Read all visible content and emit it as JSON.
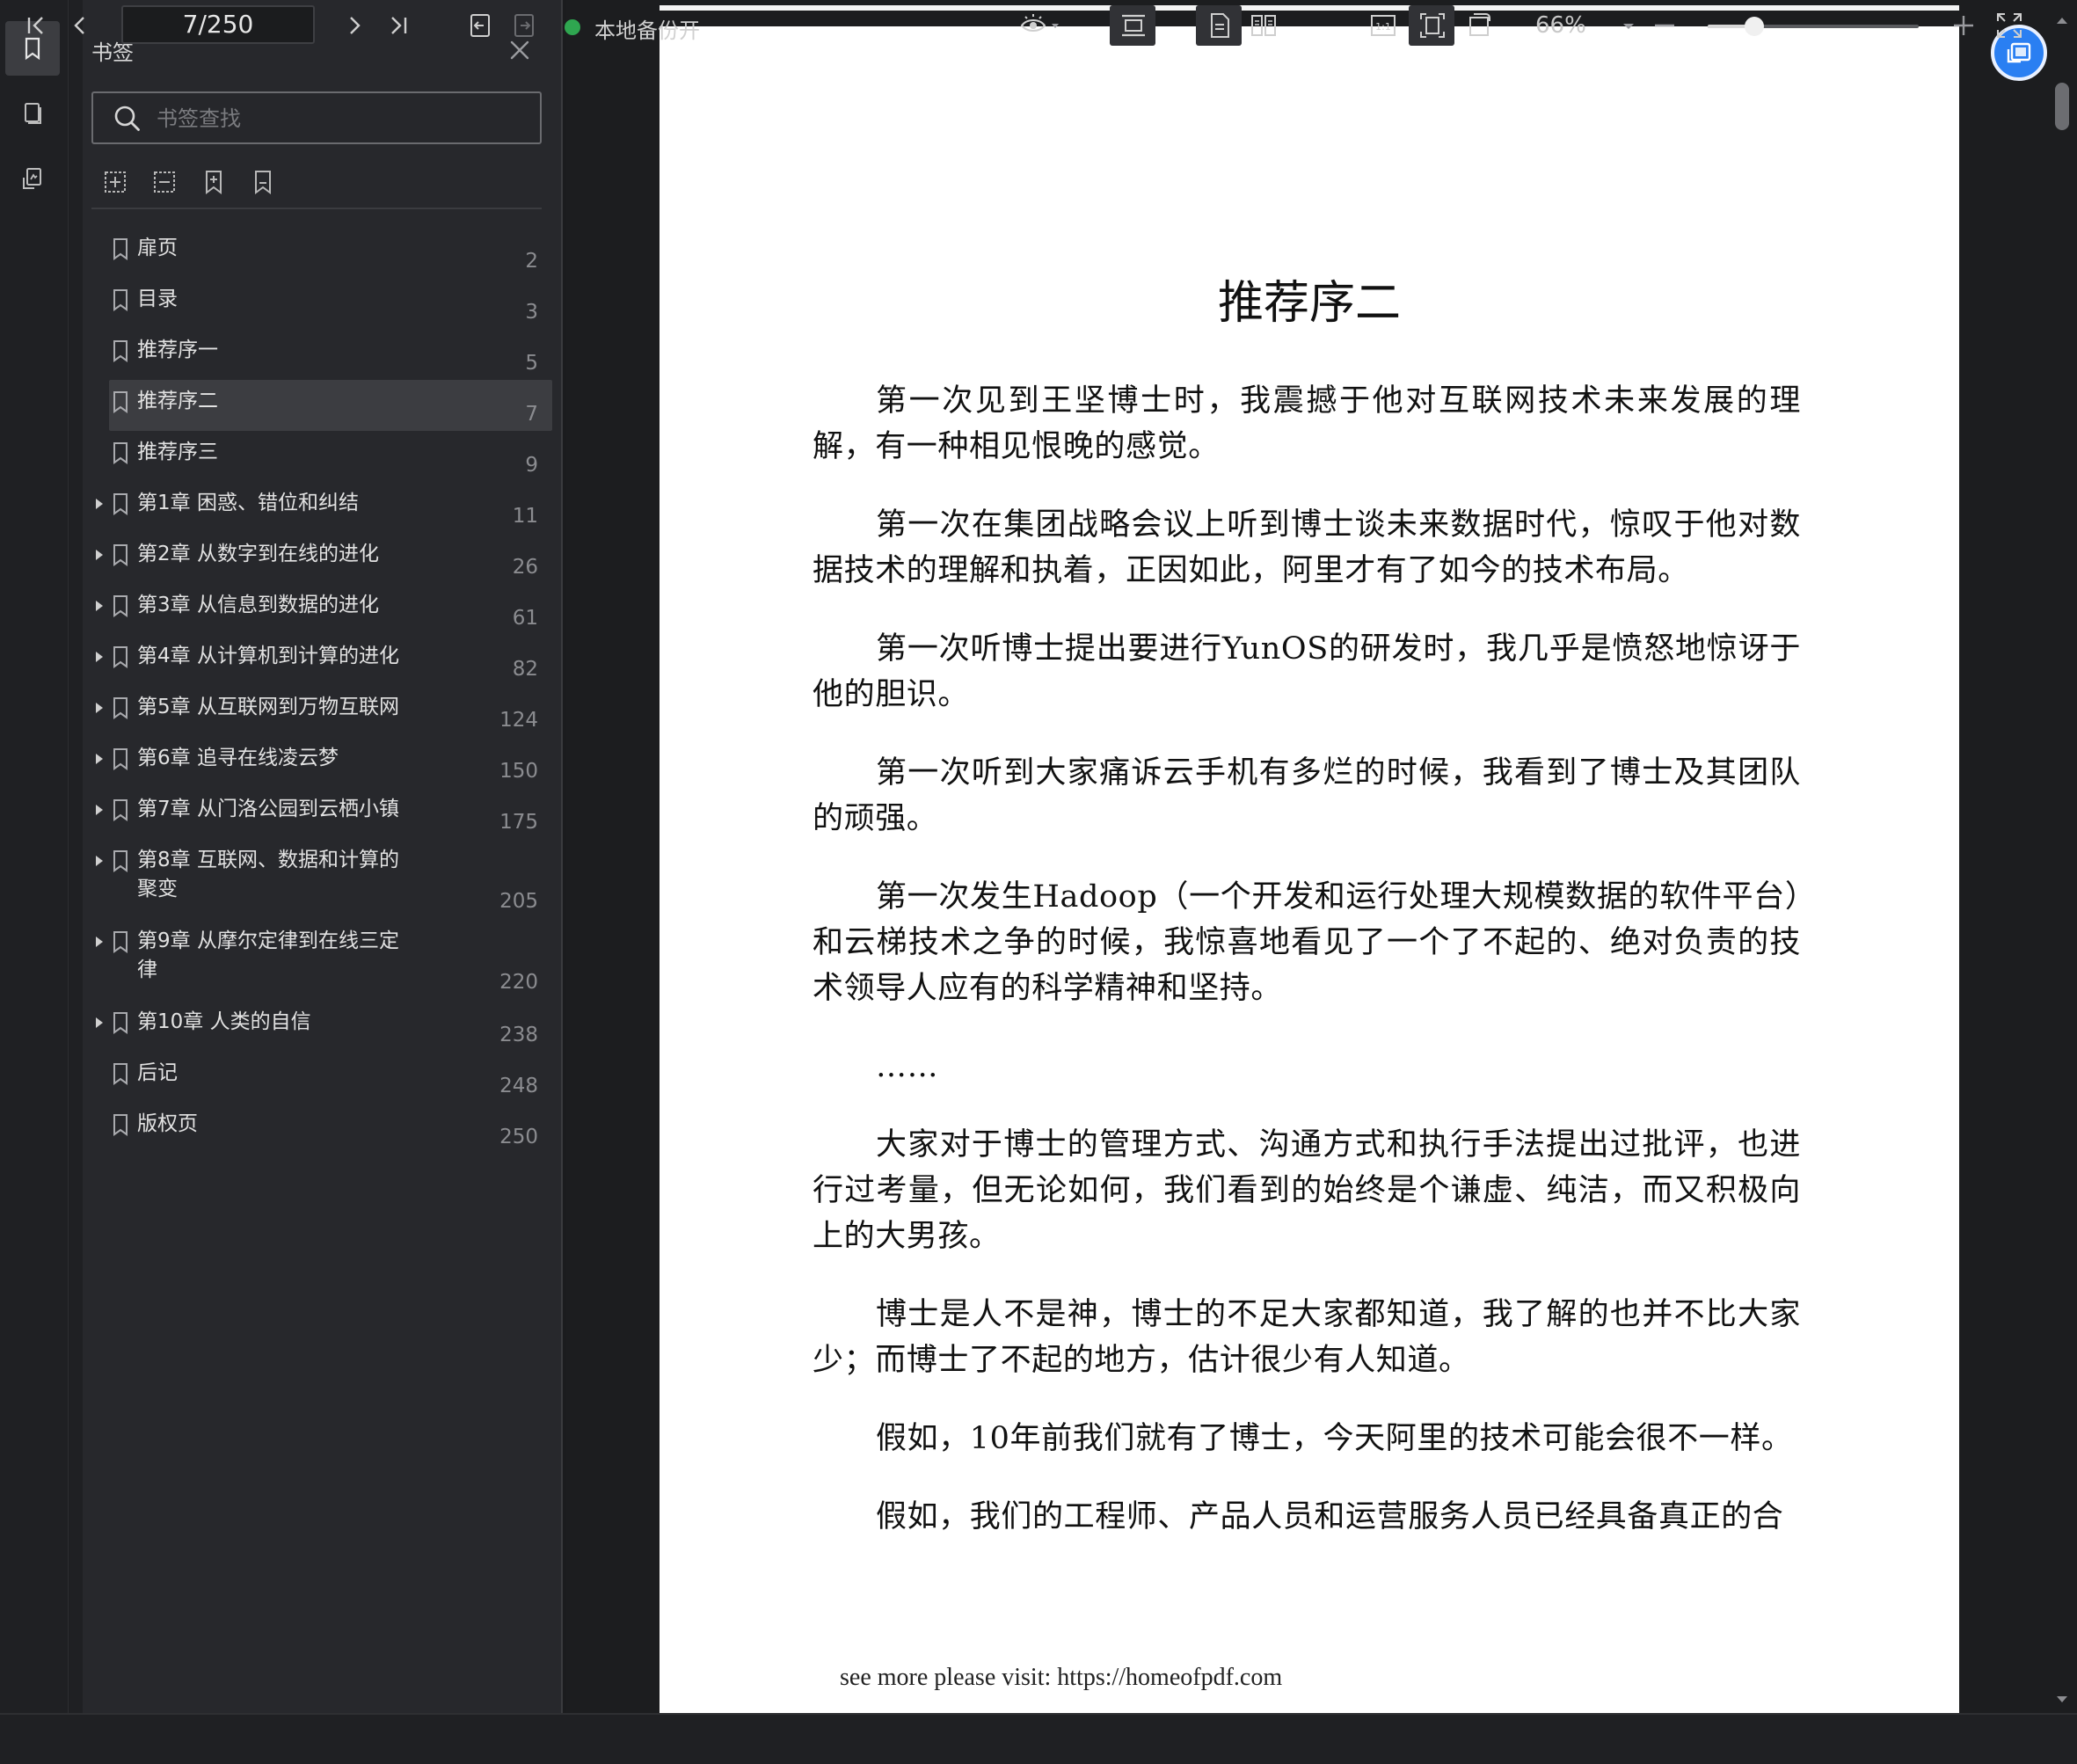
{
  "sidebar": {
    "title": "书签",
    "search_placeholder": "书签查找",
    "items": [
      {
        "label": "扉页",
        "page": "2",
        "expandable": false,
        "selected": false
      },
      {
        "label": "目录",
        "page": "3",
        "expandable": false,
        "selected": false
      },
      {
        "label": "推荐序一",
        "page": "5",
        "expandable": false,
        "selected": false
      },
      {
        "label": "推荐序二",
        "page": "7",
        "expandable": false,
        "selected": true
      },
      {
        "label": "推荐序三",
        "page": "9",
        "expandable": false,
        "selected": false
      },
      {
        "label": "第1章 困惑、错位和纠结",
        "page": "11",
        "expandable": true,
        "selected": false
      },
      {
        "label": "第2章 从数字到在线的进化",
        "page": "26",
        "expandable": true,
        "selected": false
      },
      {
        "label": "第3章 从信息到数据的进化",
        "page": "61",
        "expandable": true,
        "selected": false
      },
      {
        "label": "第4章 从计算机到计算的进化",
        "page": "82",
        "expandable": true,
        "selected": false
      },
      {
        "label": "第5章 从互联网到万物互联网",
        "page": "124",
        "expandable": true,
        "selected": false
      },
      {
        "label": "第6章 追寻在线凌云梦",
        "page": "150",
        "expandable": true,
        "selected": false
      },
      {
        "label": "第7章 从门洛公园到云栖小镇",
        "page": "175",
        "expandable": true,
        "selected": false
      },
      {
        "label": "第8章 互联网、数据和计算的聚变",
        "page": "205",
        "expandable": true,
        "selected": false
      },
      {
        "label": "第9章 从摩尔定律到在线三定律",
        "page": "220",
        "expandable": true,
        "selected": false
      },
      {
        "label": "第10章 人类的自信",
        "page": "238",
        "expandable": true,
        "selected": false
      },
      {
        "label": "后记",
        "page": "248",
        "expandable": false,
        "selected": false
      },
      {
        "label": "版权页",
        "page": "250",
        "expandable": false,
        "selected": false
      }
    ]
  },
  "document": {
    "title": "推荐序二",
    "paragraphs": [
      "第一次见到王坚博士时，我震撼于他对互联网技术未来发展的理解，有一种相见恨晚的感觉。",
      "第一次在集团战略会议上听到博士谈未来数据时代，惊叹于他对数据技术的理解和执着，正因如此，阿里才有了如今的技术布局。",
      "第一次听博士提出要进行YunOS的研发时，我几乎是愤怒地惊讶于他的胆识。",
      "第一次听到大家痛诉云手机有多烂的时候，我看到了博士及其团队的顽强。",
      "第一次发生Hadoop（一个开发和运行处理大规模数据的软件平台）和云梯技术之争的时候，我惊喜地看见了一个了不起的、绝对负责的技术领导人应有的科学精神和坚持。",
      "……",
      "大家对于博士的管理方式、沟通方式和执行手法提出过批评，也进行过考量，但无论如何，我们看到的始终是个谦虚、纯洁，而又积极向上的大男孩。",
      "博士是人不是神，博士的不足大家都知道，我了解的也并不比大家少；而博士了不起的地方，估计很少有人知道。",
      "假如，10年前我们就有了博士，今天阿里的技术可能会很不一样。",
      "假如，我们的工程师、产品人员和运营服务人员已经具备真正的合"
    ],
    "footer": "see more please visit: https://homeofpdf.com"
  },
  "bottombar": {
    "page_indicator": "7/250",
    "backup_label": "本地备份开",
    "zoom_label": "66%",
    "zoom_level": 0.22
  },
  "colors": {
    "accent": "#2a7ff2",
    "backup_status": "#2fa650",
    "selected_row": "#3c3d41"
  }
}
